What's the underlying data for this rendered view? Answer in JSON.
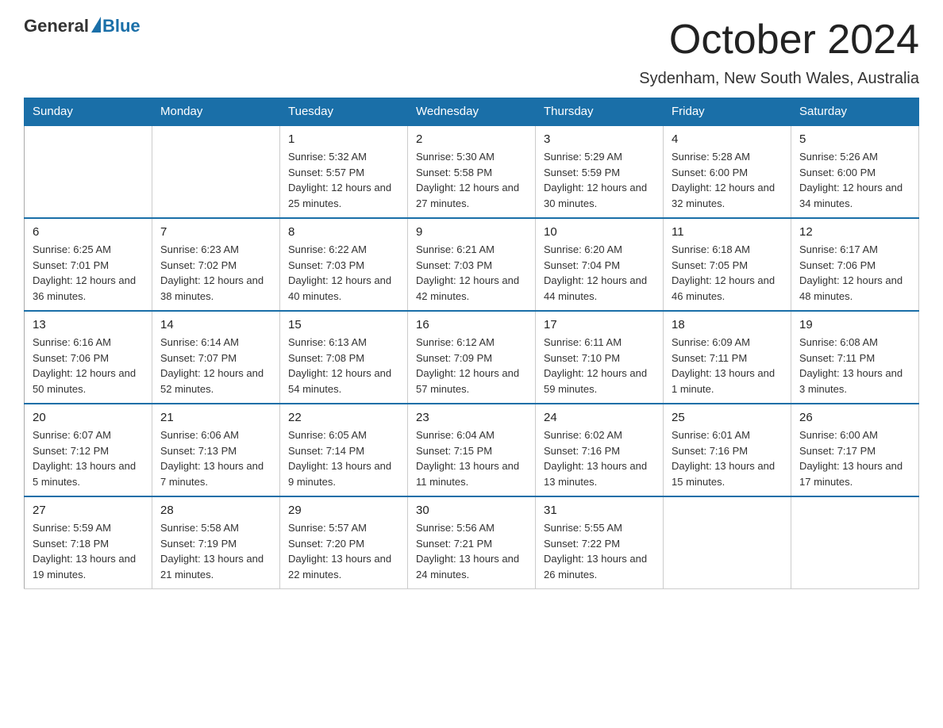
{
  "logo": {
    "text_general": "General",
    "text_blue": "Blue"
  },
  "header": {
    "month_title": "October 2024",
    "location": "Sydenham, New South Wales, Australia"
  },
  "weekdays": [
    "Sunday",
    "Monday",
    "Tuesday",
    "Wednesday",
    "Thursday",
    "Friday",
    "Saturday"
  ],
  "weeks": [
    [
      {
        "day": "",
        "sunrise": "",
        "sunset": "",
        "daylight": ""
      },
      {
        "day": "",
        "sunrise": "",
        "sunset": "",
        "daylight": ""
      },
      {
        "day": "1",
        "sunrise": "Sunrise: 5:32 AM",
        "sunset": "Sunset: 5:57 PM",
        "daylight": "Daylight: 12 hours and 25 minutes."
      },
      {
        "day": "2",
        "sunrise": "Sunrise: 5:30 AM",
        "sunset": "Sunset: 5:58 PM",
        "daylight": "Daylight: 12 hours and 27 minutes."
      },
      {
        "day": "3",
        "sunrise": "Sunrise: 5:29 AM",
        "sunset": "Sunset: 5:59 PM",
        "daylight": "Daylight: 12 hours and 30 minutes."
      },
      {
        "day": "4",
        "sunrise": "Sunrise: 5:28 AM",
        "sunset": "Sunset: 6:00 PM",
        "daylight": "Daylight: 12 hours and 32 minutes."
      },
      {
        "day": "5",
        "sunrise": "Sunrise: 5:26 AM",
        "sunset": "Sunset: 6:00 PM",
        "daylight": "Daylight: 12 hours and 34 minutes."
      }
    ],
    [
      {
        "day": "6",
        "sunrise": "Sunrise: 6:25 AM",
        "sunset": "Sunset: 7:01 PM",
        "daylight": "Daylight: 12 hours and 36 minutes."
      },
      {
        "day": "7",
        "sunrise": "Sunrise: 6:23 AM",
        "sunset": "Sunset: 7:02 PM",
        "daylight": "Daylight: 12 hours and 38 minutes."
      },
      {
        "day": "8",
        "sunrise": "Sunrise: 6:22 AM",
        "sunset": "Sunset: 7:03 PM",
        "daylight": "Daylight: 12 hours and 40 minutes."
      },
      {
        "day": "9",
        "sunrise": "Sunrise: 6:21 AM",
        "sunset": "Sunset: 7:03 PM",
        "daylight": "Daylight: 12 hours and 42 minutes."
      },
      {
        "day": "10",
        "sunrise": "Sunrise: 6:20 AM",
        "sunset": "Sunset: 7:04 PM",
        "daylight": "Daylight: 12 hours and 44 minutes."
      },
      {
        "day": "11",
        "sunrise": "Sunrise: 6:18 AM",
        "sunset": "Sunset: 7:05 PM",
        "daylight": "Daylight: 12 hours and 46 minutes."
      },
      {
        "day": "12",
        "sunrise": "Sunrise: 6:17 AM",
        "sunset": "Sunset: 7:06 PM",
        "daylight": "Daylight: 12 hours and 48 minutes."
      }
    ],
    [
      {
        "day": "13",
        "sunrise": "Sunrise: 6:16 AM",
        "sunset": "Sunset: 7:06 PM",
        "daylight": "Daylight: 12 hours and 50 minutes."
      },
      {
        "day": "14",
        "sunrise": "Sunrise: 6:14 AM",
        "sunset": "Sunset: 7:07 PM",
        "daylight": "Daylight: 12 hours and 52 minutes."
      },
      {
        "day": "15",
        "sunrise": "Sunrise: 6:13 AM",
        "sunset": "Sunset: 7:08 PM",
        "daylight": "Daylight: 12 hours and 54 minutes."
      },
      {
        "day": "16",
        "sunrise": "Sunrise: 6:12 AM",
        "sunset": "Sunset: 7:09 PM",
        "daylight": "Daylight: 12 hours and 57 minutes."
      },
      {
        "day": "17",
        "sunrise": "Sunrise: 6:11 AM",
        "sunset": "Sunset: 7:10 PM",
        "daylight": "Daylight: 12 hours and 59 minutes."
      },
      {
        "day": "18",
        "sunrise": "Sunrise: 6:09 AM",
        "sunset": "Sunset: 7:11 PM",
        "daylight": "Daylight: 13 hours and 1 minute."
      },
      {
        "day": "19",
        "sunrise": "Sunrise: 6:08 AM",
        "sunset": "Sunset: 7:11 PM",
        "daylight": "Daylight: 13 hours and 3 minutes."
      }
    ],
    [
      {
        "day": "20",
        "sunrise": "Sunrise: 6:07 AM",
        "sunset": "Sunset: 7:12 PM",
        "daylight": "Daylight: 13 hours and 5 minutes."
      },
      {
        "day": "21",
        "sunrise": "Sunrise: 6:06 AM",
        "sunset": "Sunset: 7:13 PM",
        "daylight": "Daylight: 13 hours and 7 minutes."
      },
      {
        "day": "22",
        "sunrise": "Sunrise: 6:05 AM",
        "sunset": "Sunset: 7:14 PM",
        "daylight": "Daylight: 13 hours and 9 minutes."
      },
      {
        "day": "23",
        "sunrise": "Sunrise: 6:04 AM",
        "sunset": "Sunset: 7:15 PM",
        "daylight": "Daylight: 13 hours and 11 minutes."
      },
      {
        "day": "24",
        "sunrise": "Sunrise: 6:02 AM",
        "sunset": "Sunset: 7:16 PM",
        "daylight": "Daylight: 13 hours and 13 minutes."
      },
      {
        "day": "25",
        "sunrise": "Sunrise: 6:01 AM",
        "sunset": "Sunset: 7:16 PM",
        "daylight": "Daylight: 13 hours and 15 minutes."
      },
      {
        "day": "26",
        "sunrise": "Sunrise: 6:00 AM",
        "sunset": "Sunset: 7:17 PM",
        "daylight": "Daylight: 13 hours and 17 minutes."
      }
    ],
    [
      {
        "day": "27",
        "sunrise": "Sunrise: 5:59 AM",
        "sunset": "Sunset: 7:18 PM",
        "daylight": "Daylight: 13 hours and 19 minutes."
      },
      {
        "day": "28",
        "sunrise": "Sunrise: 5:58 AM",
        "sunset": "Sunset: 7:19 PM",
        "daylight": "Daylight: 13 hours and 21 minutes."
      },
      {
        "day": "29",
        "sunrise": "Sunrise: 5:57 AM",
        "sunset": "Sunset: 7:20 PM",
        "daylight": "Daylight: 13 hours and 22 minutes."
      },
      {
        "day": "30",
        "sunrise": "Sunrise: 5:56 AM",
        "sunset": "Sunset: 7:21 PM",
        "daylight": "Daylight: 13 hours and 24 minutes."
      },
      {
        "day": "31",
        "sunrise": "Sunrise: 5:55 AM",
        "sunset": "Sunset: 7:22 PM",
        "daylight": "Daylight: 13 hours and 26 minutes."
      },
      {
        "day": "",
        "sunrise": "",
        "sunset": "",
        "daylight": ""
      },
      {
        "day": "",
        "sunrise": "",
        "sunset": "",
        "daylight": ""
      }
    ]
  ]
}
